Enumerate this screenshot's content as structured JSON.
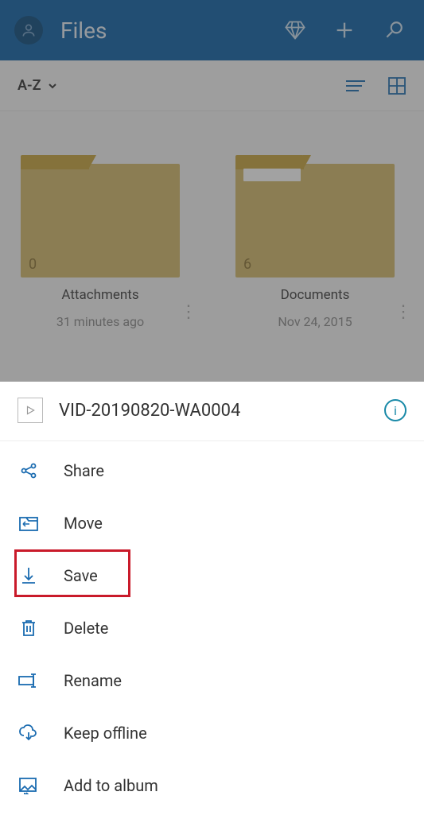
{
  "header": {
    "title": "Files"
  },
  "toolbar": {
    "sort_label": "A-Z"
  },
  "folders": [
    {
      "name": "Attachments",
      "meta": "31 minutes ago",
      "count": "0",
      "has_strip": false
    },
    {
      "name": "Documents",
      "meta": "Nov 24, 2015",
      "count": "6",
      "has_strip": true
    }
  ],
  "sheet": {
    "title": "VID-20190820-WA0004",
    "items": [
      {
        "label": "Share"
      },
      {
        "label": "Move"
      },
      {
        "label": "Save"
      },
      {
        "label": "Delete"
      },
      {
        "label": "Rename"
      },
      {
        "label": "Keep offline"
      },
      {
        "label": "Add to album"
      }
    ]
  }
}
